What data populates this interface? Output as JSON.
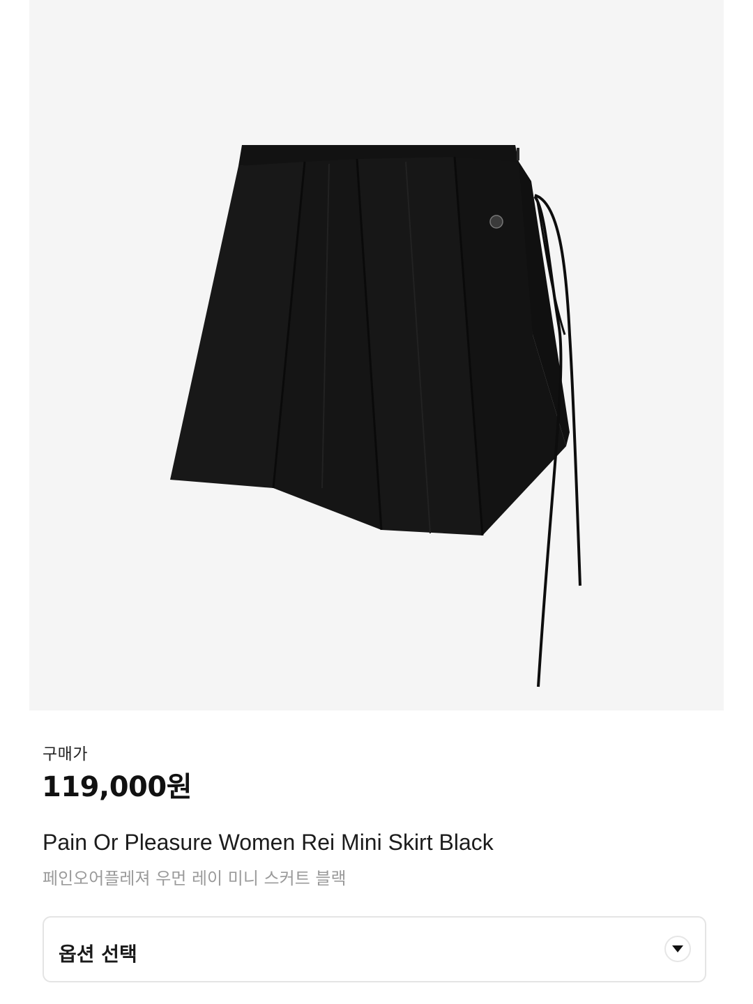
{
  "product": {
    "image_alt": "product-photo-black-pleated-wrap-mini-skirt",
    "price_label": "구매가",
    "price": "119,000원",
    "name_en": "Pain Or Pleasure Women Rei Mini Skirt Black",
    "name_ko": "페인오어플레져 우먼 레이 미니 스커트 블랙"
  },
  "options": {
    "label": "옵션 선택",
    "icon": "chevron-down-icon"
  },
  "colors": {
    "image_bg": "#f5f5f5",
    "skirt": "#141414",
    "text_primary": "#1a1a1a",
    "text_secondary": "#9a9a9a",
    "border": "#e4e4e4"
  }
}
